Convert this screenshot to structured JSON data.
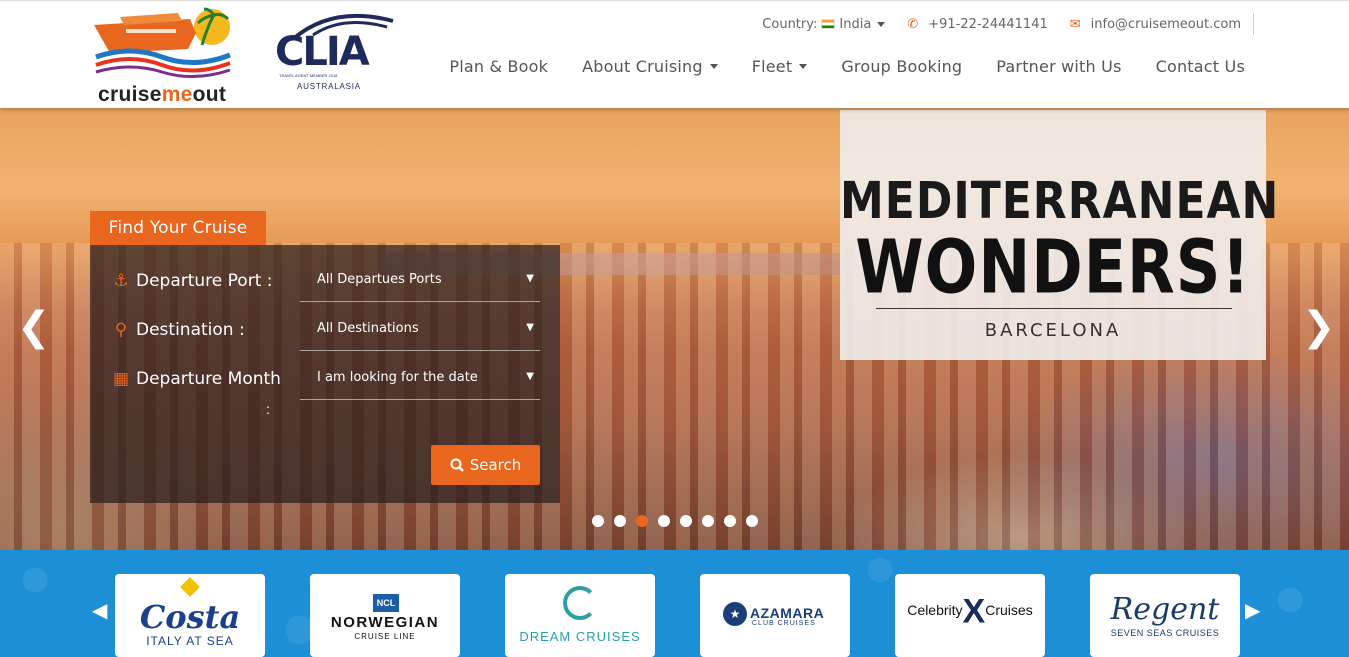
{
  "header": {
    "logo_text_a": "cruise",
    "logo_text_b": "me",
    "logo_text_c": "out",
    "partner_logo": {
      "word": "CLIA",
      "sub": "TRAVEL AGENT MEMBER 2018",
      "region": "AUSTRALASIA"
    },
    "topbar": {
      "country_label": "Country:",
      "country_value": "India",
      "phone": "+91-22-24441141",
      "email": "info@cruisemeout.com"
    },
    "nav": [
      {
        "label": "Plan & Book",
        "dropdown": false
      },
      {
        "label": "About Cruising",
        "dropdown": true
      },
      {
        "label": "Fleet",
        "dropdown": true
      },
      {
        "label": "Group Booking",
        "dropdown": false
      },
      {
        "label": "Partner with Us",
        "dropdown": false
      },
      {
        "label": "Contact Us",
        "dropdown": false
      }
    ]
  },
  "hero": {
    "promo": {
      "line1": "MEDITERRANEAN",
      "line2": "WONDERS!",
      "line3": "BARCELONA"
    },
    "slides_count": 8,
    "active_slide": 3
  },
  "finder": {
    "tab_label": "Find Your Cruise",
    "fields": [
      {
        "label": "Departure Port :",
        "icon": "anchor-icon",
        "value": "All Departues Ports"
      },
      {
        "label": "Destination :",
        "icon": "map-marker-icon",
        "value": "All Destinations"
      },
      {
        "label": "Departure Month",
        "icon": "calendar-icon",
        "value": "I am looking for the date"
      }
    ],
    "month_colon": ":",
    "search_label": "Search"
  },
  "cruise_lines": [
    {
      "name": "Costa",
      "sub": "ITALY AT SEA"
    },
    {
      "name": "NORWEGIAN",
      "badge": "NCL",
      "sub": "CRUISE LINE"
    },
    {
      "name": "DREAM CRUISES"
    },
    {
      "name": "AZAMARA",
      "sub": "CLUB CRUISES"
    },
    {
      "name_a": "Celebrity",
      "name_x": "X",
      "name_b": "Cruises"
    },
    {
      "name": "Regent",
      "sub": "SEVEN SEAS CRUISES"
    }
  ],
  "colors": {
    "accent": "#e8661e",
    "band": "#1d8fd6",
    "navy": "#1f2a5c"
  }
}
